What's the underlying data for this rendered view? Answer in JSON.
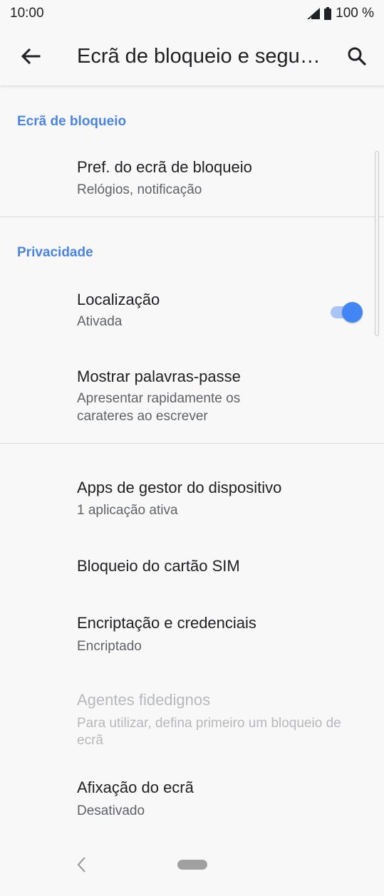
{
  "status_bar": {
    "time": "10:00",
    "battery": "100 %",
    "icons": [
      "signal-icon",
      "battery-icon"
    ]
  },
  "app_bar": {
    "title": "Ecrã de bloqueio e segurança",
    "back_icon": "arrow-back-icon",
    "search_icon": "search-icon"
  },
  "sections": {
    "lock_screen": {
      "header": "Ecrã de bloqueio",
      "items": [
        {
          "title": "Pref. do ecrã de bloqueio",
          "subtitle": "Relógios, notificação"
        }
      ]
    },
    "privacy": {
      "header": "Privacidade",
      "items": [
        {
          "title": "Localização",
          "subtitle": "Ativada"
        },
        {
          "title": "Mostrar palavras-passe",
          "subtitle_line1": "Apresentar rapidamente os",
          "subtitle_line2": "carateres ao escrever",
          "toggle": true
        }
      ]
    },
    "other": {
      "items": [
        {
          "title": "Apps de gestor do dispositivo",
          "subtitle": "1 aplicação ativa"
        },
        {
          "title": "Bloqueio do cartão SIM"
        },
        {
          "title": "Encriptação e credenciais",
          "subtitle": "Encriptado"
        },
        {
          "title": "Agentes fidedignos",
          "subtitle_line1": "Para utilizar, defina primeiro um bloqueio de",
          "subtitle_line2": "ecrã",
          "disabled": true
        },
        {
          "title": "Afixação do ecrã",
          "subtitle": "Desativado"
        }
      ]
    }
  },
  "colors": {
    "accent": "#4285f4",
    "section_header": "#4a84e6",
    "background": "#f8f8f8"
  },
  "nav_bar": {
    "icons": [
      "nav-back-icon",
      "nav-home-pill"
    ]
  }
}
